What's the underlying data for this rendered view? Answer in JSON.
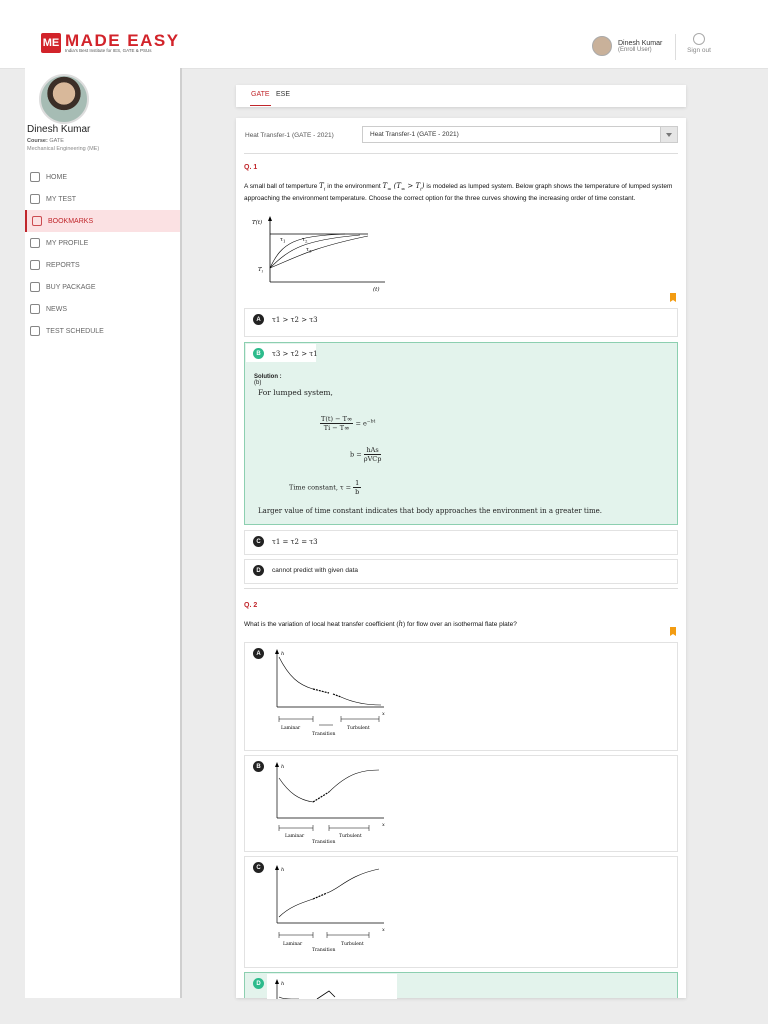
{
  "header": {
    "logo_mark": "ME",
    "logo_name": "MADE EASY",
    "logo_tagline": "India's Best Institute for IES, GATE & PSUs",
    "user_name": "Dinesh Kumar",
    "user_role": "(Enroll User)",
    "signout_label": "Sign out"
  },
  "profile": {
    "name": "Dinesh Kumar",
    "course_label": "Course:",
    "course_value": "GATE",
    "branch": "Mechanical Engineering (ME)"
  },
  "menu": [
    {
      "label": "HOME",
      "icon": "home-icon"
    },
    {
      "label": "MY TEST",
      "icon": "test-icon"
    },
    {
      "label": "BOOKMARKS",
      "icon": "bookmark-icon",
      "active": true
    },
    {
      "label": "MY PROFILE",
      "icon": "user-icon"
    },
    {
      "label": "REPORTS",
      "icon": "pie-chart-icon"
    },
    {
      "label": "BUY PACKAGE",
      "icon": "cart-icon"
    },
    {
      "label": "NEWS",
      "icon": "news-icon"
    },
    {
      "label": "TEST SCHEDULE",
      "icon": "schedule-icon"
    }
  ],
  "tabs": [
    {
      "label": "GATE",
      "active": true
    },
    {
      "label": "ESE"
    }
  ],
  "paper": {
    "label": "Heat Transfer-1 (GATE - 2021)",
    "selected": "Heat Transfer-1 (GATE - 2021)"
  },
  "q1": {
    "number": "Q. 1",
    "text_a": "A small ball of temperture ",
    "text_b": " in the environment ",
    "text_c": " is modeled as lumped system. Below graph shows the temperature of lumped system approaching the environment temperature. Choose the correct option for the three curves showing the increasing order of time constant.",
    "sym_ti": "T",
    "sym_ti_sub": "i",
    "sym_cond": "(T",
    "sym_cond_2": " > T",
    "sym_cond_sub": "i",
    "graph": {
      "y_label": "T(t)",
      "x_label": "(t)",
      "start_label": "T",
      "start_sub": "i",
      "curve_labels": [
        "τ",
        "τ",
        "τ"
      ],
      "curve_subs": [
        "1",
        "2",
        "3"
      ]
    },
    "options": [
      {
        "badge": "A",
        "text": "τ1 > τ2 > τ3"
      },
      {
        "badge": "B",
        "text": "τ3 > τ2 > τ1",
        "correct": true
      },
      {
        "badge": "C",
        "text": "τ1 = τ2 = τ3"
      },
      {
        "badge": "D",
        "text": "cannot predict with given data"
      }
    ],
    "solution": {
      "label": "Solution :",
      "answer": "(b)",
      "line1": "For lumped system,",
      "eq1_num": "T(t) − T∞",
      "eq1_den": "Ti − T∞",
      "eq1_rhs": "= e",
      "eq1_exp": "−bt",
      "eq2_lhs": "b =",
      "eq2_num": "hAs",
      "eq2_den": "ρVCp",
      "eq3_lhs": "Time constant, τ =",
      "eq3_num": "1",
      "eq3_den": "b",
      "conclusion": "Larger value of time constant indicates that body approaches the environment in a greater time."
    }
  },
  "q2": {
    "number": "Q. 2",
    "text_a": "What is the variation of local heat transfer coefficient (",
    "text_h": "h",
    "text_b": ") for flow over an isothermal flate plate?",
    "graph_labels": {
      "y": "h",
      "x": "x",
      "laminar": "Laminar",
      "transition": "Transition",
      "turbulent": "Turbulent"
    },
    "options": [
      {
        "badge": "A"
      },
      {
        "badge": "B"
      },
      {
        "badge": "C"
      },
      {
        "badge": "D",
        "correct": true
      }
    ]
  },
  "colors": {
    "accent": "#c0262b",
    "correct": "#2dbb8c",
    "bookmark": "#f39c12"
  }
}
